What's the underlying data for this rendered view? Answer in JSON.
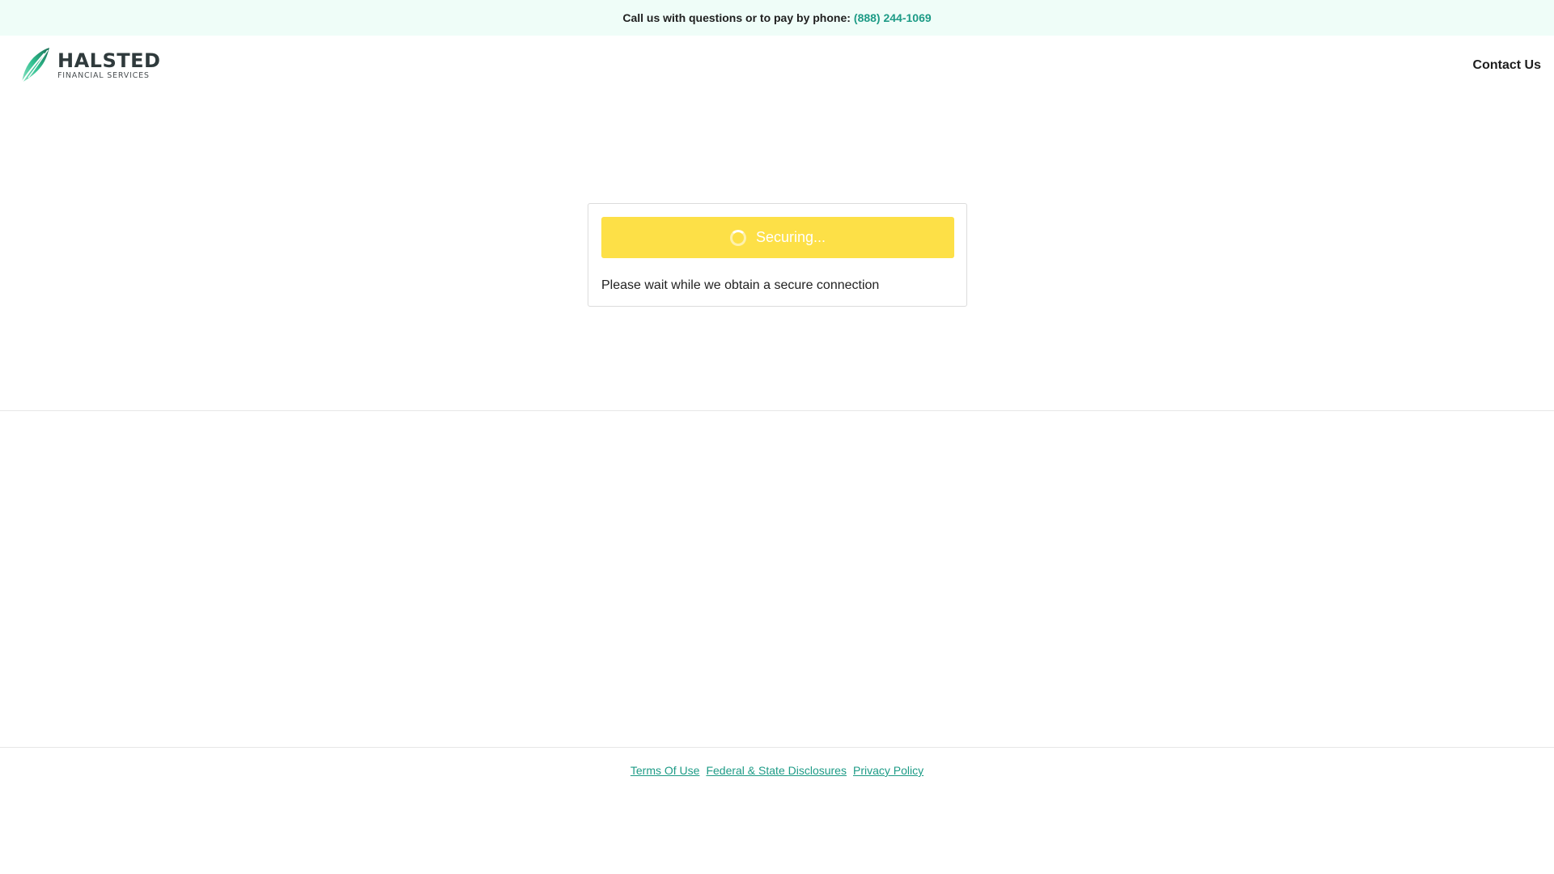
{
  "topbar": {
    "text": "Call us with questions or to pay by phone:",
    "phone": "(888) 244-1069"
  },
  "header": {
    "logo": {
      "name": "HALSTED",
      "subtitle": "FINANCIAL SERVICES"
    },
    "contact_label": "Contact Us"
  },
  "card": {
    "button_label": "Securing...",
    "message": "Please wait while we obtain a secure connection"
  },
  "footer": {
    "links": [
      "Terms Of Use",
      "Federal & State Disclosures",
      "Privacy Policy"
    ]
  },
  "colors": {
    "accent": "#1d9b86",
    "topbar_bg": "#effdf8",
    "button_bg": "#fde047"
  },
  "icons": {
    "logo_mark": "leaf-logo-icon",
    "spinner": "spinner-icon"
  }
}
